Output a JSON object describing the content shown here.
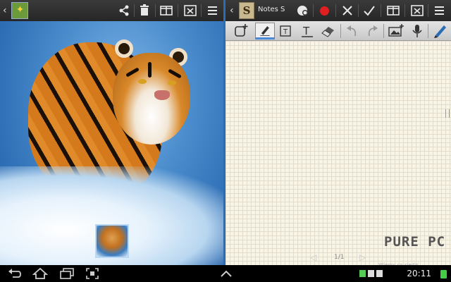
{
  "left_pane": {
    "app": "gallery",
    "icons": [
      "back-icon",
      "gallery-app-icon",
      "share-icon",
      "delete-icon",
      "split-view-icon",
      "close-window-icon",
      "menu-icon"
    ],
    "thumbnail": "tiger-thumbnail"
  },
  "right_pane": {
    "app_title": "Notes S",
    "app_icon_letter": "S",
    "toolbar_icons": [
      "record-icon",
      "close-icon",
      "check-icon",
      "split-view-icon",
      "close-window-icon",
      "menu-icon"
    ],
    "tools": [
      "crop-insert-icon",
      "pen-icon",
      "text-box-icon",
      "text-icon",
      "eraser-icon",
      "undo-icon",
      "redo-icon",
      "insert-image-icon",
      "microphone-icon",
      "brush-icon"
    ],
    "active_tool": "pen-icon",
    "page_indicator": "1/1"
  },
  "watermark": {
    "logo": "PURE PC",
    "tagline": "Wiemy co siedzi"
  },
  "system_bar": {
    "clock": "20:11",
    "icons": [
      "back-nav-icon",
      "home-nav-icon",
      "recent-apps-icon",
      "screenshot-icon",
      "chevron-up-icon"
    ]
  },
  "colors": {
    "accent": "#2a6db5",
    "record": "#e02020",
    "paper": "#f8f4e8"
  }
}
